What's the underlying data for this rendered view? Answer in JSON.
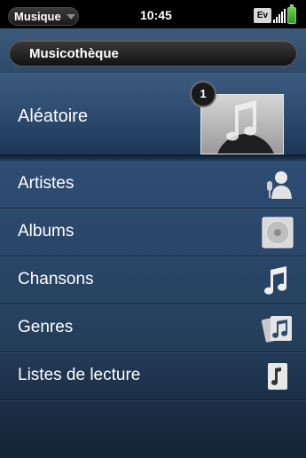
{
  "statusbar": {
    "app_menu_label": "Musique",
    "time": "10:45",
    "network_label": "Ev"
  },
  "header": {
    "title": "Musicothèque"
  },
  "shuffle": {
    "label": "Aléatoire",
    "badge": "1"
  },
  "items": [
    {
      "label": "Artistes",
      "icon": "artist-icon"
    },
    {
      "label": "Albums",
      "icon": "album-disc-icon"
    },
    {
      "label": "Chansons",
      "icon": "music-notes-icon"
    },
    {
      "label": "Genres",
      "icon": "genres-stack-icon"
    },
    {
      "label": "Listes de lecture",
      "icon": "playlist-icon"
    }
  ],
  "colors": {
    "list_bg": "#2e4d73",
    "battery": "#4cc23a"
  }
}
